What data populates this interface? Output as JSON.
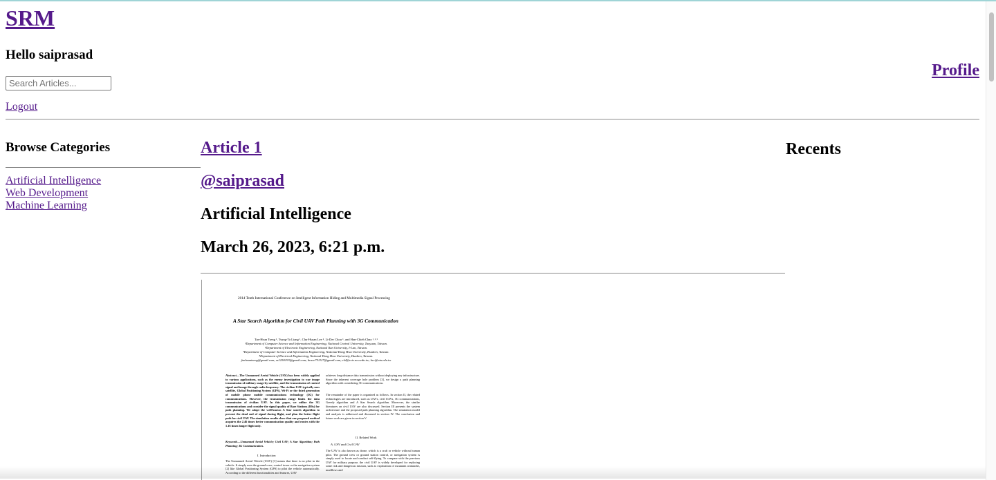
{
  "header": {
    "site_title": "SRM",
    "greeting": "Hello saiprasad",
    "search_placeholder": "Search Articles...",
    "logout_label": "Logout",
    "profile_label": "Profile"
  },
  "sidebar": {
    "heading": "Browse Categories",
    "categories": [
      {
        "label": "Artificial Intelligence"
      },
      {
        "label": "Web Development"
      },
      {
        "label": "Machine Learning"
      }
    ]
  },
  "article": {
    "title": "Article 1",
    "author": "@saiprasad",
    "category": "Artificial Intelligence",
    "date": "March 26, 2023, 6:21 p.m.",
    "attachment": {
      "conference": "2014 Tenth International Conference on Intelligent Information Hiding and Multimedia Signal Processing",
      "paper_title": "A Star Search Algorithm for Civil UAV Path Planning with 3G Communication",
      "authors": "Tan-Hsun Tseng ¹, Tsung-Ta Liang ¹, Chu-Hsuan Lee ², Li-Der Chou ¹, and Han-Chieh Chao ¹˒²˒³",
      "affiliations": [
        "¹Department of Computer Science and Information Engineering, National Central University, Taoyuan, Taiwan.",
        "²Department of Electronic Engineering, National Ilan University, I-Lan, Taiwan.",
        "³Department of Computer Science and Information Engineering, National Dong Hwa University, Hualien, Taiwan.",
        "⁴Department of Electrical Engineering, National Dong Hwa University, Hualien, Taiwan."
      ],
      "emails": "fonhsuntseng@gmail.com; ss1250193@gmail.com; bruce751127@gmail.com; cld@csie.ncu.edu.tw; hcc@niu.edu.tw",
      "abstract": "Abstract—The Unmanned Aerial Vehicle (UAV) has been widely applied to various applications, such as the enemy investigation to war image transmission of military usage by satellite, and the transmission of control signal and image through radio frequency. The civilian UAV typically uses satellite, Global Positioning System (GPS), Wi-Fi or the third generation of mobile phone mobile communications technology (3G) for communications. However, the transmission range limits the data transmission of civilian UAV. In this paper, we utilize the 3G communications and consider the signal quality of Base Stations (BSs) for path planning. We adopt the well-known A Star search algorithm to prevent the dead end of signal during flight, and plan the better flight path for civil UAV. The simulation results show that our proposed method acquires the 2.46 times better communication quality and routes with the 1.16 times longer flight only.",
      "keywords": "Keywords—Unmanned Aerial Vehicle; Civil UAV; A Star Algorithm; Path Planning; 3G Communication.",
      "intro_heading": "I. Introduction",
      "intro_text": "The Unmanned Aerial Vehicle (UAV) [1] means that there is no pilot in the vehicle. It simply uses the ground crew, control tower or the navigation system [2] like Global Positioning System (GPS) to pilot the vehicle automatically. According to the different functionalities and features, UAV",
      "col2_text": "achieves long-distance data transmission without deploying any infrastructure. Since the inherent coverage hole problem [3], we design a path planning algorithm with considering 3G communications.",
      "col2_text2": "The remainder of the paper is organized as follows. In section II, the related technologies are introduced, such as UAVs, civil UAVs, 3G communications, Greedy algorithm and A Star Search algorithm. Moreover, the similar literatures on civil UAV are also discussed. Section III presents the system architecture and the proposed path planning algorithm. The simulation model and analysis is addressed and discussed in section IV. The conclusion and future work are given in section V.",
      "related_heading": "II. Related Work",
      "uav_heading": "A. UAV and Civil UAV",
      "col2_text3": "The UAV is also known as drone, which is a craft or vehicle without human pilot. The ground crew or ground station control, or navigation system is simply used to locate and conduct self-flying. To compare with the previous UAV for military purpose, the civil UAV is widely developed for replacing some risk and dangerous mission, such as exploration of mountain avalanche, mudflows and"
    }
  },
  "recents": {
    "heading": "Recents"
  }
}
